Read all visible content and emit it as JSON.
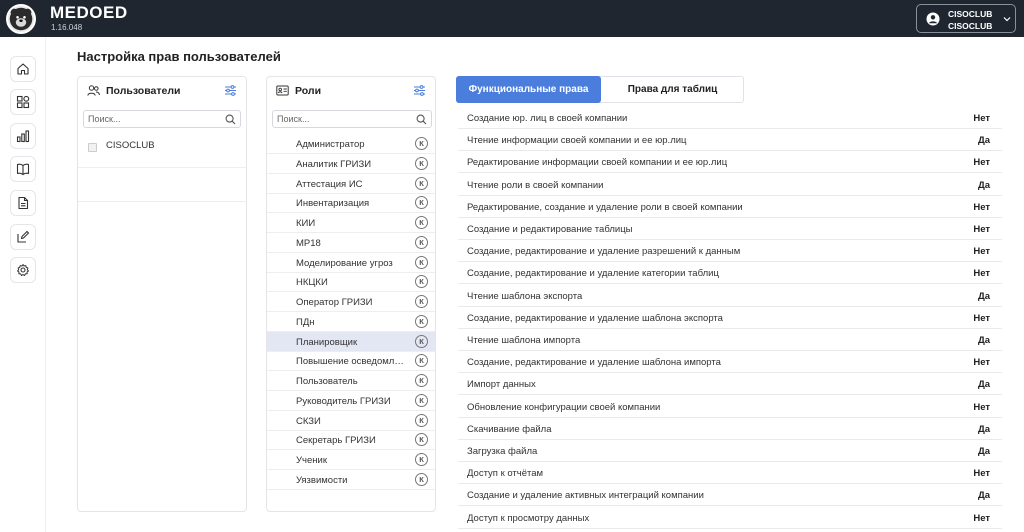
{
  "app": {
    "brand": "MEDOED",
    "version": "1.16.048"
  },
  "user": {
    "line1": "CISOCLUB",
    "line2": "CISOCLUB"
  },
  "nav": [
    "home-icon",
    "widgets-icon",
    "chart-icon",
    "book-icon",
    "document-icon",
    "edit-icon",
    "gear-icon"
  ],
  "page": {
    "title": "Настройка прав пользователей"
  },
  "users_panel": {
    "title": "Пользователи",
    "search_placeholder": "Поиск...",
    "items": [
      {
        "name": "CISOCLUB",
        "checked": false
      }
    ]
  },
  "roles_panel": {
    "title": "Роли",
    "search_placeholder": "Поиск...",
    "badge": "К",
    "selected_index": 10,
    "items": [
      "Администратор",
      "Аналитик ГРИЗИ",
      "Аттестация ИС",
      "Инвентаризация",
      "КИИ",
      "МР18",
      "Моделирование угроз",
      "НКЦКИ",
      "Оператор ГРИЗИ",
      "ПДн",
      "Планировщик",
      "Повышение осведомленности",
      "Пользователь",
      "Руководитель ГРИЗИ",
      "СКЗИ",
      "Секретарь ГРИЗИ",
      "Ученик",
      "Уязвимости"
    ]
  },
  "tabs": {
    "functional": "Функциональные права",
    "tables": "Права для таблиц",
    "active": "functional"
  },
  "permissions": [
    {
      "name": "Создание юр. лиц в своей компании",
      "value": "Нет"
    },
    {
      "name": "Чтение информации своей компании и ее юр.лиц",
      "value": "Да"
    },
    {
      "name": "Редактирование информации своей компании и ее юр.лиц",
      "value": "Нет"
    },
    {
      "name": "Чтение роли в своей компании",
      "value": "Да"
    },
    {
      "name": "Редактирование, создание и удаление роли в своей компании",
      "value": "Нет"
    },
    {
      "name": "Создание и редактирование таблицы",
      "value": "Нет"
    },
    {
      "name": "Создание, редактирование и удаление разрешений к данным",
      "value": "Нет"
    },
    {
      "name": "Создание, редактирование и удаление категории таблиц",
      "value": "Нет"
    },
    {
      "name": "Чтение шаблона экспорта",
      "value": "Да"
    },
    {
      "name": "Создание, редактирование и удаление шаблона экспорта",
      "value": "Нет"
    },
    {
      "name": "Чтение шаблона импорта",
      "value": "Да"
    },
    {
      "name": "Создание, редактирование и удаление шаблона импорта",
      "value": "Нет"
    },
    {
      "name": "Импорт данных",
      "value": "Да"
    },
    {
      "name": "Обновление конфигурации своей компании",
      "value": "Нет"
    },
    {
      "name": "Скачивание файла",
      "value": "Да"
    },
    {
      "name": "Загрузка файла",
      "value": "Да"
    },
    {
      "name": "Доступ к отчётам",
      "value": "Нет"
    },
    {
      "name": "Создание и удаление активных интеграций компании",
      "value": "Да"
    },
    {
      "name": "Доступ к просмотру данных",
      "value": "Нет"
    }
  ]
}
